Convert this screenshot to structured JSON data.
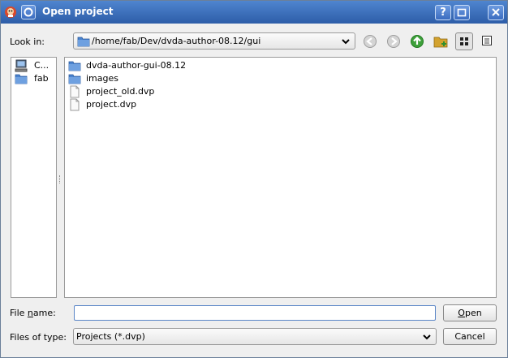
{
  "window": {
    "title": "Open project"
  },
  "title_buttons": {
    "help": "?"
  },
  "look_in": {
    "label": "Look in:",
    "path": "/home/fab/Dev/dvda-author-08.12/gui"
  },
  "sidebar": {
    "items": [
      {
        "label": "C...",
        "icon": "computer-icon"
      },
      {
        "label": "fab",
        "icon": "folder-icon"
      }
    ]
  },
  "files": [
    {
      "name": "dvda-author-gui-08.12",
      "icon": "folder-icon"
    },
    {
      "name": "images",
      "icon": "folder-icon"
    },
    {
      "name": "project_old.dvp",
      "icon": "file-icon"
    },
    {
      "name": "project.dvp",
      "icon": "file-icon"
    }
  ],
  "file_name": {
    "label_pre": "File ",
    "label_u": "n",
    "label_post": "ame:",
    "value": ""
  },
  "files_of_type": {
    "label": "Files of type:",
    "value": "Projects (*.dvp)"
  },
  "buttons": {
    "open_u": "O",
    "open_rest": "pen",
    "cancel": "Cancel"
  },
  "colors": {
    "titlebar": "#2d5da8",
    "folder": "#4a83cf",
    "accent": "#5b86c7"
  }
}
